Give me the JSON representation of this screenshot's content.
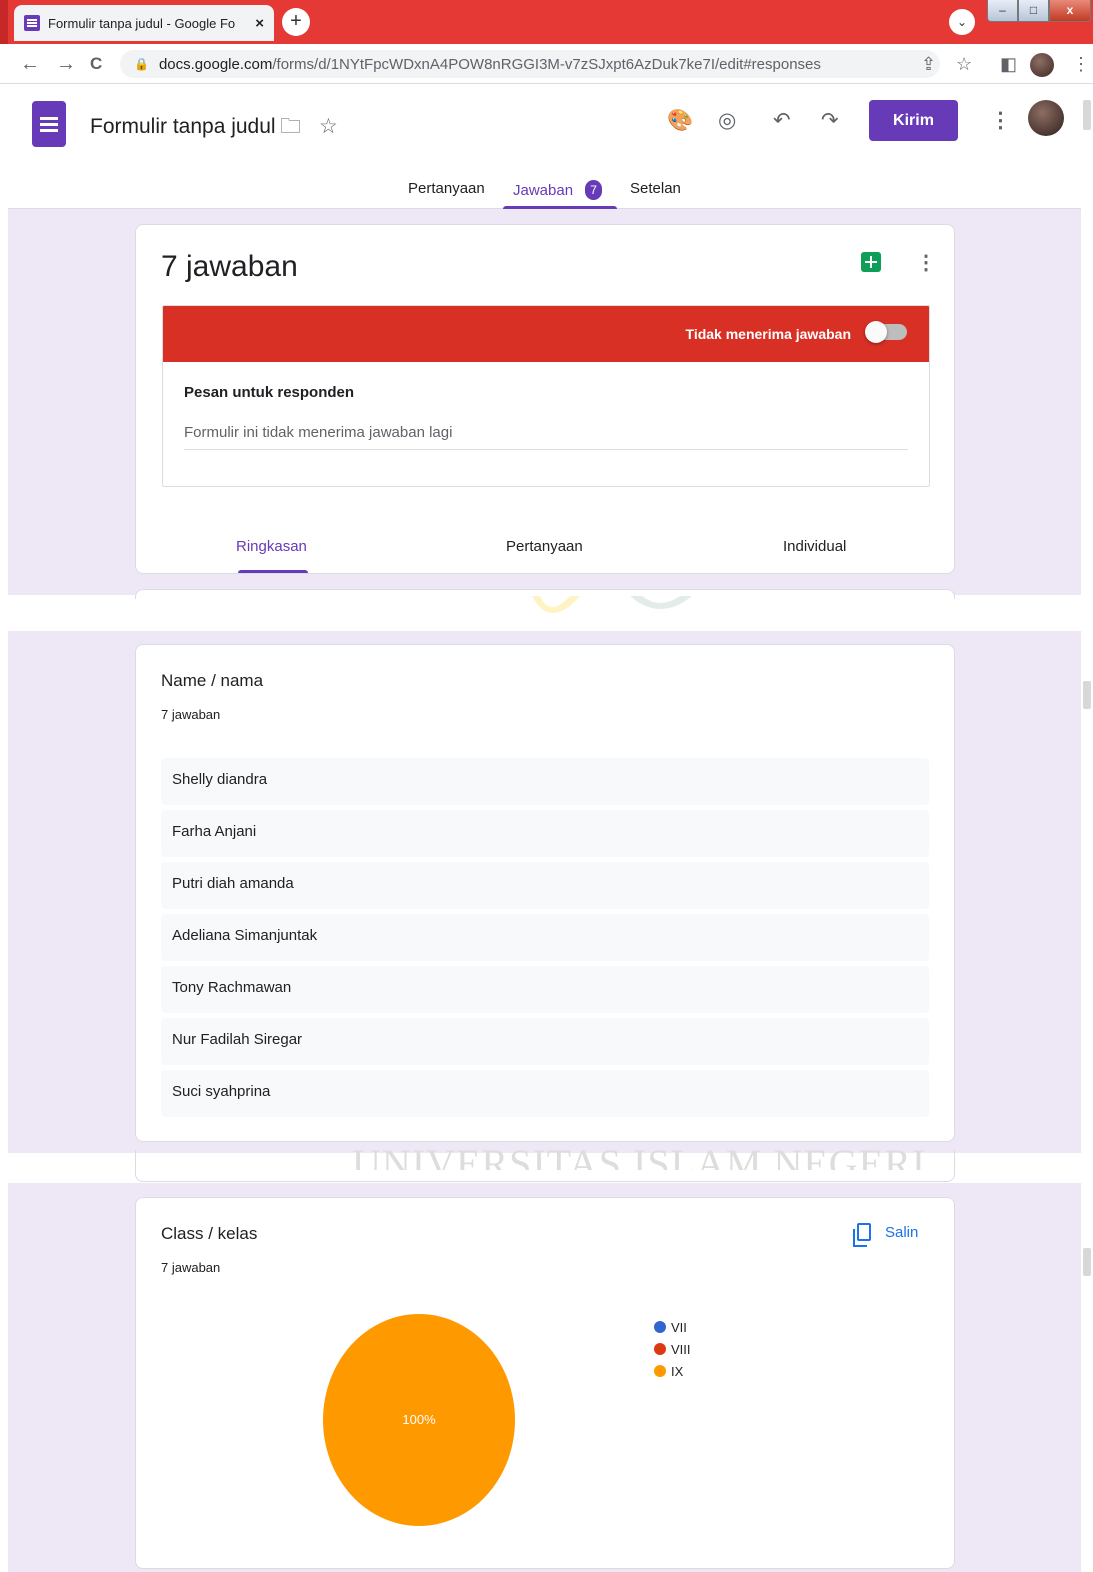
{
  "browser": {
    "tab_title": "Formulir tanpa judul - Google Fo",
    "tab_close": "×",
    "new_tab": "+",
    "tab_search": "⌄",
    "window": {
      "minimize": "–",
      "maximize": "□",
      "close": "x"
    },
    "url_host": "docs.google.com",
    "url_path": "/forms/d/1NYtFpcWDxnA4POW8nRGGI3M-v7zSJxpt6AzDuk7ke7I/edit#responses",
    "icons": {
      "back": "←",
      "forward": "→",
      "reload": "C",
      "lock": "🔒",
      "share": "⇪",
      "star": "☆",
      "sidepanel": "◧",
      "menu": "⋮"
    }
  },
  "header": {
    "form_title": "Formulir tanpa judul",
    "folder_icon": "🗀",
    "star_icon": "☆",
    "palette_icon": "🎨",
    "preview_icon": "◎",
    "undo_icon": "↶",
    "redo_icon": "↷",
    "send_label": "Kirim",
    "more_icon": "⋮",
    "tabs": {
      "questions": "Pertanyaan",
      "responses": "Jawaban",
      "responses_count": "7",
      "settings": "Setelan"
    }
  },
  "summary_card": {
    "title": "7 jawaban",
    "closed_banner": "Tidak menerima jawaban",
    "message_label": "Pesan untuk responden",
    "message_value": "Formulir ini tidak menerima jawaban lagi",
    "more_icon": "⋮",
    "subtabs": {
      "summary": "Ringkasan",
      "question": "Pertanyaan",
      "individual": "Individual"
    }
  },
  "watermark_text": "UNIVERSITAS ISLAM NEGERI",
  "name_question": {
    "title": "Name / nama",
    "count": "7 jawaban",
    "answers": [
      "Shelly diandra",
      "Farha Anjani",
      "Putri diah amanda",
      "Adeliana Simanjuntak",
      "Tony Rachmawan",
      "Nur Fadilah Siregar",
      "Suci syahprina"
    ]
  },
  "class_question": {
    "title": "Class / kelas",
    "count": "7 jawaban",
    "copy_label": "Salin"
  },
  "colors": {
    "accent": "#673ab7",
    "banner": "#d93025",
    "vii": "#3366cc",
    "viii": "#dc3912",
    "ix": "#ff9900"
  },
  "chart_data": {
    "type": "pie",
    "categories": [
      "VII",
      "VIII",
      "IX"
    ],
    "values": [
      0,
      0,
      100
    ],
    "colors": [
      "#3366cc",
      "#dc3912",
      "#ff9900"
    ],
    "data_labels": [
      "",
      "",
      "100%"
    ],
    "legend": "right"
  }
}
